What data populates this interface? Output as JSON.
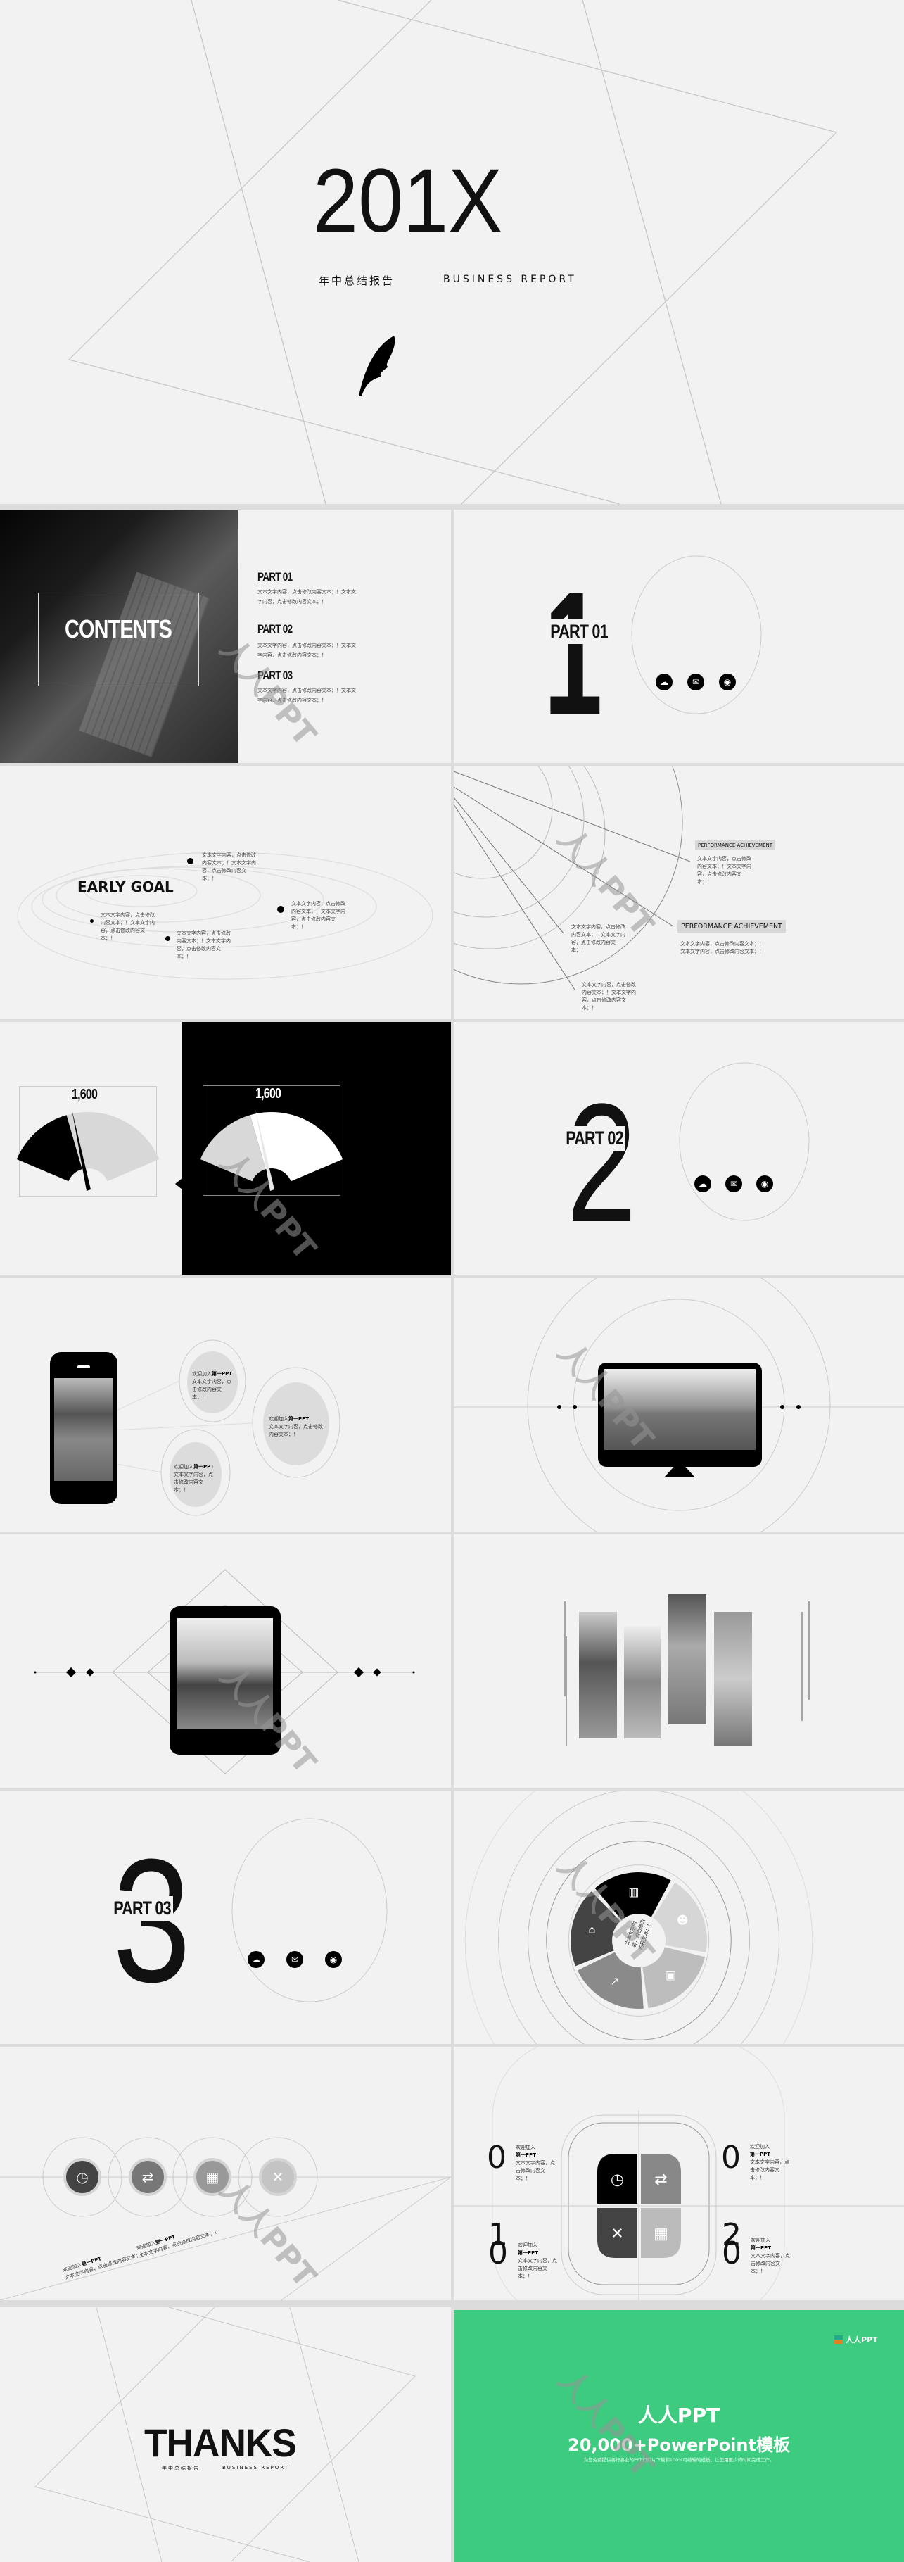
{
  "cover": {
    "title": "201X",
    "subtitle_cn": "年中总结报告",
    "subtitle_en": "BUSINESS REPORT",
    "icon": "feather-icon"
  },
  "contents": {
    "title": "CONTENTS",
    "items": [
      {
        "label": "PART 01",
        "desc": "文本文字内容，点击修改内容文本；！文本文字内容，点击修改内容文本；！"
      },
      {
        "label": "PART 02",
        "desc": "文本文字内容，点击修改内容文本；！文本文字内容，点击修改内容文本；！"
      },
      {
        "label": "PART 03",
        "desc": "文本文字内容，点击修改内容文本；！文本文字内容，点击修改内容文本；！"
      }
    ]
  },
  "part01": {
    "number": "1",
    "label": "PART 01",
    "icons": [
      "cloud-download-icon",
      "wechat-icon",
      "weibo-icon"
    ]
  },
  "part02": {
    "number": "2",
    "label": "PART 02",
    "icons": [
      "cloud-download-icon",
      "wechat-icon",
      "weibo-icon"
    ]
  },
  "part03": {
    "number": "3",
    "label": "PART 03",
    "icons": [
      "cloud-download-icon",
      "wechat-icon",
      "weibo-icon"
    ]
  },
  "early_goal": {
    "title": "EARLY GOAL",
    "texts": [
      "文本文字内容，点击修改内容文本；！文本文字内容，点击修改内容文本；！",
      "文本文字内容，点击修改内容文本；！文本文字内容，点击修改内容文本；！",
      "文本文字内容，点击修改内容文本；！文本文字内容，点击修改内容文本；！",
      "文本文字内容，点击修改内容文本；！文本文字内容，点击修改内容文本；！"
    ]
  },
  "performance": {
    "label_small": "PERFORMANCE ACHIEVEMENT",
    "label_large": "PERFORMANCE ACHIEVEMENT",
    "text_small": "文本文字内容，点击修改内容文本；！文本文字内容，点击修改内容文本；！",
    "text_large": "文本文字内容，点击修改内容文本；！文本文字内容，点击修改内容文本；！",
    "text_a": "文本文字内容，点击修改内容文本；！文本文字内容，点击修改内容文本；！",
    "text_b": "文本文字内容，点击修改内容文本；！文本文字内容，点击修改内容文本；！"
  },
  "gauges": {
    "value_left": "1,600",
    "value_right": "1,600",
    "fill_fraction": 0.38
  },
  "phone": {
    "bubbles": [
      {
        "prefix": "欢迎加入",
        "brand": "第一PPT",
        "text": "文本文字内容，点击修改内容文本；！"
      },
      {
        "prefix": "欢迎加入",
        "brand": "第一PPT",
        "text": "文本文字内容，点击修改内容文本；！"
      },
      {
        "prefix": "欢迎加入",
        "brand": "第一PPT",
        "text": "文本文字内容，点击修改内容文本；！"
      }
    ]
  },
  "cycle": {
    "center_text": "文本文字内容，点击修改内容文本；！",
    "icons": [
      "sliders-icon",
      "users-icon",
      "truck-icon",
      "chart-icon",
      "home-icon"
    ],
    "colors": [
      "#000000",
      "#d6d6d6",
      "#bdbdbd",
      "#8a8a8a",
      "#444444"
    ]
  },
  "timeline": {
    "icons": [
      "clock-icon",
      "swap-icon",
      "apps-icon",
      "tools-icon"
    ],
    "captions": [
      {
        "prefix": "欢迎加入",
        "brand": "第一PPT",
        "text": "文本文字内容，点击修改内容文本；！"
      },
      {
        "prefix": "欢迎加入",
        "brand": "第一PPT",
        "text": "文本文字内容，点击修改内容文本；！"
      }
    ]
  },
  "quad": {
    "icons": [
      "clock-icon",
      "swap-icon",
      "tools-icon",
      "apps-icon"
    ],
    "items": [
      {
        "num": "0",
        "prefix": "欢迎加入",
        "brand": "第一PPT",
        "text": "文本文字内容，点击修改内容文本；！"
      },
      {
        "num": "0",
        "prefix": "欢迎加入",
        "brand": "第一PPT",
        "text": "文本文字内容，点击修改内容文本；！"
      },
      {
        "num": "10",
        "prefix": "欢迎加入",
        "brand": "第一PPT",
        "text": "文本文字内容，点击修改内容文本；！"
      },
      {
        "num": "20",
        "prefix": "欢迎加入",
        "brand": "第一PPT",
        "text": "文本文字内容，点击修改内容文本；！"
      }
    ]
  },
  "thanks": {
    "title": "THANKS",
    "subtitle_cn": "年中总结报告",
    "subtitle_en": "BUSINESS REPORT"
  },
  "promo": {
    "logo": "人人PPT",
    "title": "人人PPT",
    "headline": "20,000+PowerPoint模板",
    "tagline": "为您免费提供各行各业的PPT幻灯片下载和100%可编辑的模板，让您用更少的时间完成工作。",
    "bg_color": "#3ccb7f"
  },
  "watermark": "人人PPT"
}
